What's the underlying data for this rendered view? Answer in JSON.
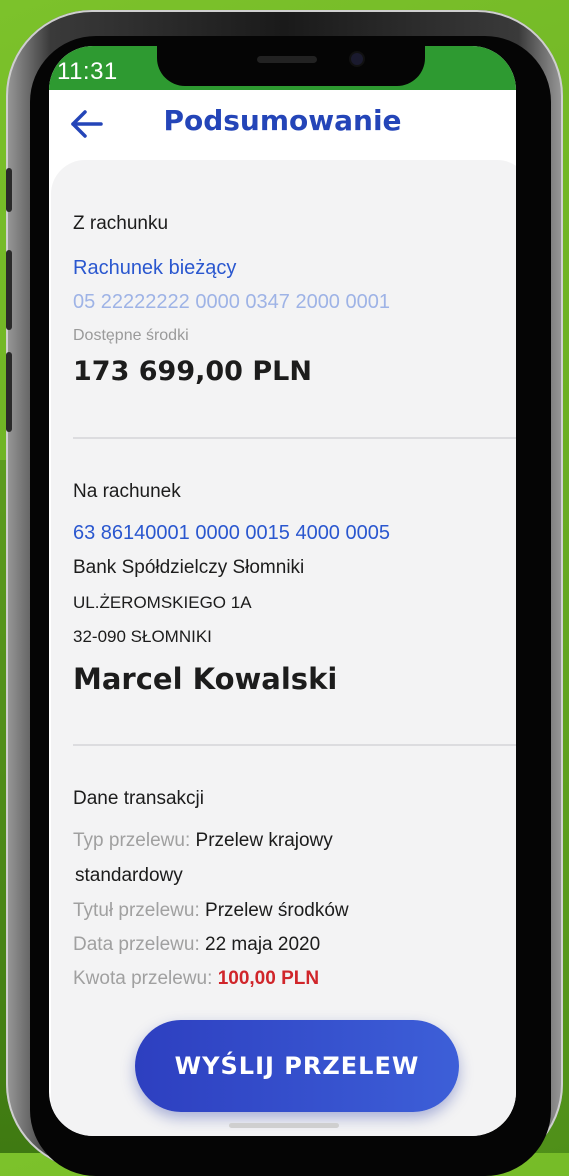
{
  "status": {
    "time": "11:31"
  },
  "header": {
    "title": "Podsumowanie"
  },
  "from": {
    "label": "Z rachunku",
    "account_name": "Rachunek bieżący",
    "account_number": "05 22222222 0000 0347 2000 0001",
    "available_label": "Dostępne środki",
    "available_amount": "173 699,00 PLN"
  },
  "to": {
    "label": "Na rachunek",
    "account_number": "63 86140001 0000 0015 4000 0005",
    "bank_name": "Bank Spółdzielczy Słomniki",
    "address_line1": "UL.ŻEROMSKIEGO 1A",
    "address_line2": "32-090 SŁOMNIKI",
    "recipient": "Marcel Kowalski"
  },
  "transaction": {
    "label": "Dane transakcji",
    "type_label": "Typ przelewu:",
    "type_value_line1": "Przelew krajowy",
    "type_value_line2": "standardowy",
    "title_label": "Tytuł przelewu:",
    "title_value": "Przelew środków",
    "date_label": "Data przelewu:",
    "date_value": "22 maja 2020",
    "amount_label": "Kwota przelewu:",
    "amount_value": "100,00 PLN"
  },
  "actions": {
    "send_label": "WYŚLIJ PRZELEW"
  },
  "colors": {
    "accent_blue": "#2445b8",
    "link_blue": "#2a57cf",
    "status_green": "#2e9a31",
    "amount_red": "#d0252a"
  },
  "icons": {
    "back": "arrow-left-icon"
  }
}
